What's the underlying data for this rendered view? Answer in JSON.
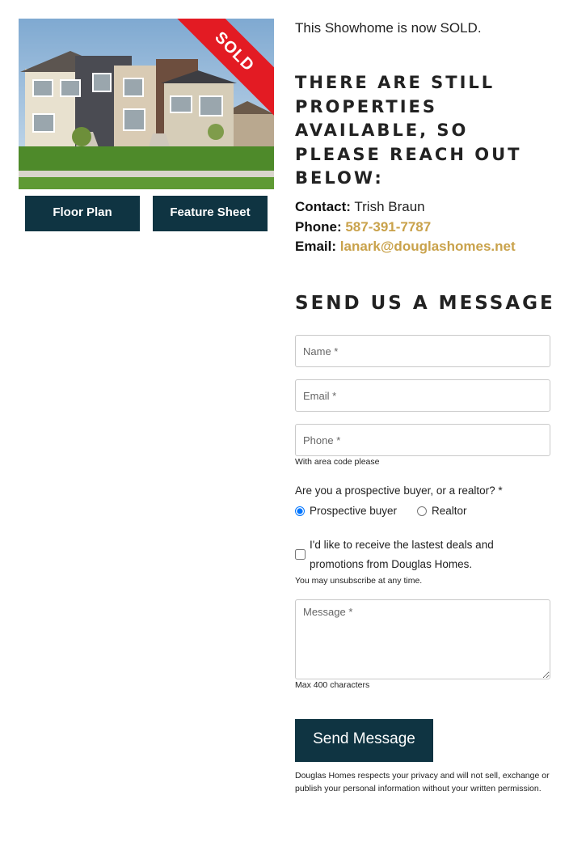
{
  "left": {
    "ribbon": "SOLD",
    "buttons": {
      "floor_plan": "Floor Plan",
      "feature_sheet": "Feature Sheet"
    }
  },
  "right": {
    "sold_note": "This Showhome is now SOLD.",
    "heading": "THERE ARE STILL PROPERTIES AVAILABLE, SO PLEASE REACH OUT BELOW:",
    "contact": {
      "contact_label": "Contact:",
      "contact_name": "Trish Braun",
      "phone_label": "Phone:",
      "phone": "587-391-7787",
      "email_label": "Email:",
      "email": "lanark@douglashomes.net"
    },
    "form": {
      "heading": "SEND US A MESSAGE",
      "name_placeholder": "Name *",
      "email_placeholder": "Email *",
      "phone_placeholder": "Phone *",
      "phone_hint": "With area code please",
      "question": "Are you a prospective buyer, or a realtor? *",
      "option_buyer": "Prospective buyer",
      "option_realtor": "Realtor",
      "selected": "Prospective buyer",
      "optin_text": "I'd like to receive the lastest deals and promotions from Douglas Homes.",
      "optin_checked": false,
      "unsubscribe_hint": "You may unsubscribe at any time.",
      "message_placeholder": "Message *",
      "max_hint": "Max 400 characters",
      "submit": "Send Message",
      "privacy": "Douglas Homes respects your privacy and will not sell, exchange or publish your personal information without your written permission."
    }
  },
  "colors": {
    "brand_dark": "#0f3442",
    "link_gold": "#c9a24b",
    "sold_red": "#e31b23"
  }
}
